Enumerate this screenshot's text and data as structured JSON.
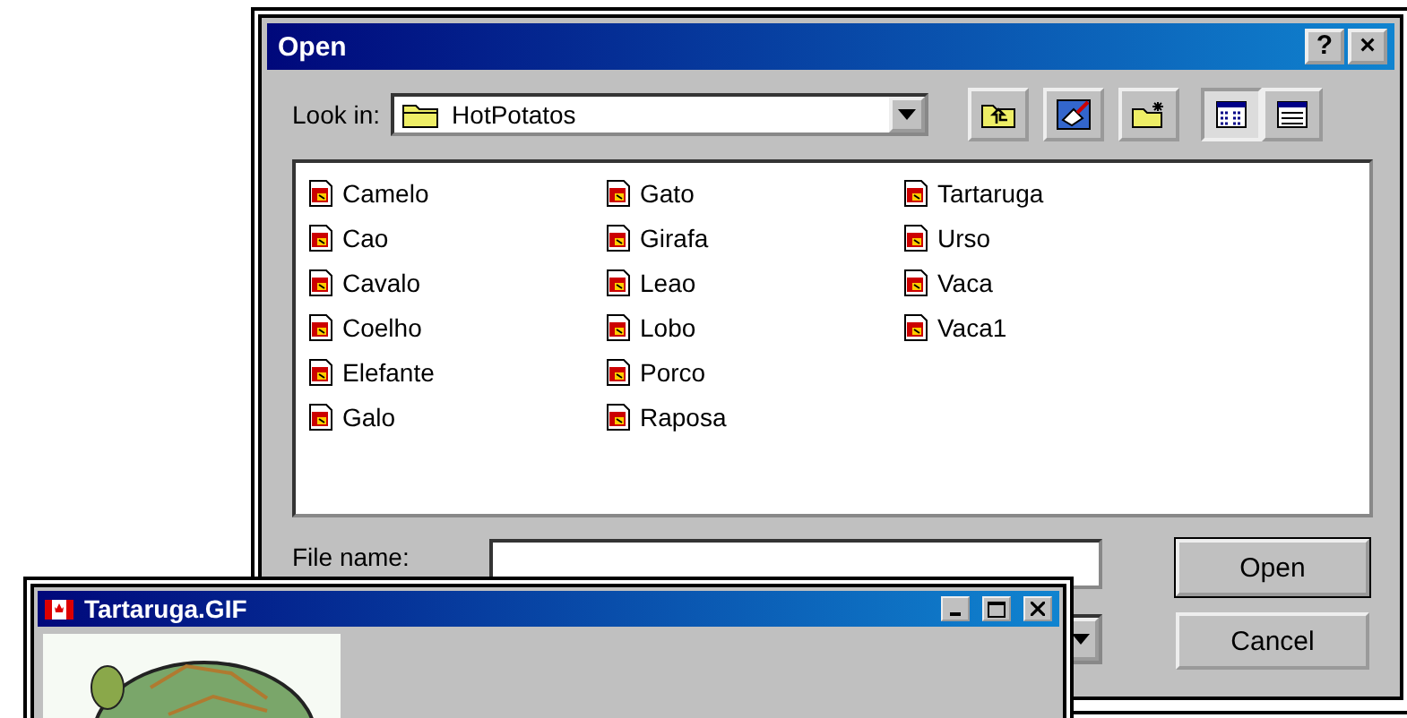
{
  "open_dialog": {
    "title": "Open",
    "title_buttons": [
      "?",
      "×"
    ],
    "look_in": {
      "label": "Look in:",
      "value": "HotPotatos"
    },
    "toolbar": [
      {
        "kind": "up",
        "selected": false
      },
      {
        "kind": "desktop",
        "selected": false
      },
      {
        "kind": "new-folder",
        "selected": false
      },
      {
        "kind": "list",
        "selected": true
      },
      {
        "kind": "details",
        "selected": false
      }
    ],
    "files": [
      {
        "name": "Camelo"
      },
      {
        "name": "Cao"
      },
      {
        "name": "Cavalo"
      },
      {
        "name": "Coelho"
      },
      {
        "name": "Elefante"
      },
      {
        "name": "Galo"
      },
      {
        "name": "Gato"
      },
      {
        "name": "Girafa"
      },
      {
        "name": "Leao"
      },
      {
        "name": "Lobo"
      },
      {
        "name": "Porco"
      },
      {
        "name": "Raposa"
      },
      {
        "name": "Tartaruga"
      },
      {
        "name": "Urso"
      },
      {
        "name": "Vaca"
      },
      {
        "name": "Vaca1"
      }
    ],
    "file_name": {
      "label": "File name:"
    },
    "buttons": [
      {
        "label": "Open",
        "default": true
      },
      {
        "label": "Cancel",
        "default": false
      }
    ]
  },
  "image_window": {
    "title": "Tartaruga.GIF"
  }
}
